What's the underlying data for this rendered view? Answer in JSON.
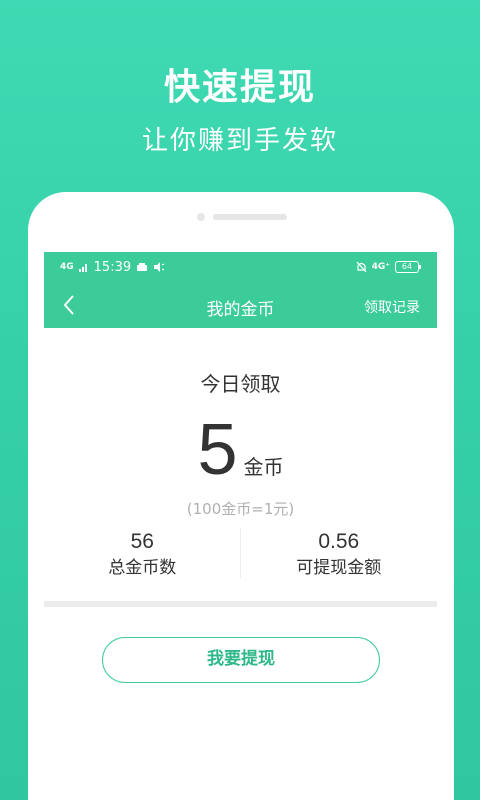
{
  "promo": {
    "title": "快速提现",
    "subtitle": "让你赚到手发软"
  },
  "status_bar": {
    "network_left": "4G",
    "time": "15:39",
    "network_right": "4G⁺",
    "battery": "64"
  },
  "nav": {
    "title": "我的金币",
    "action": "领取记录"
  },
  "today": {
    "label": "今日领取",
    "amount": "5",
    "unit": "金币",
    "rate_note": "(100金币=1元)"
  },
  "stats": {
    "total_coins_value": "56",
    "total_coins_label": "总金币数",
    "withdrawable_value": "0.56",
    "withdrawable_label": "可提现金额"
  },
  "withdraw_button": "我要提现",
  "colors": {
    "background": "#36d0a8",
    "nav_green": "#3ccc9a",
    "button_text": "#2fb989"
  }
}
